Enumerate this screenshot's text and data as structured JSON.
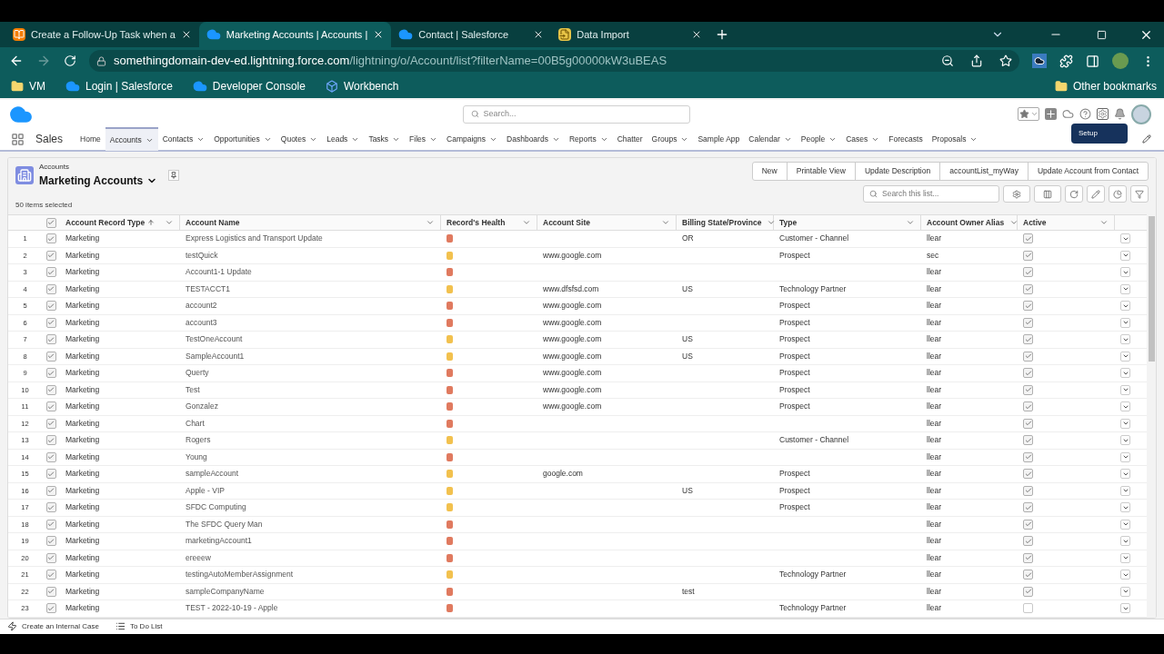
{
  "browser": {
    "tabs": [
      {
        "title": "Create a Follow-Up Task when a",
        "selected": false
      },
      {
        "title": "Marketing Accounts | Accounts |",
        "selected": true
      },
      {
        "title": "Contact | Salesforce",
        "selected": false
      },
      {
        "title": "Data Import",
        "selected": false
      }
    ],
    "url_host": "somethingdomain-dev-ed.lightning.force.com",
    "url_path": "/lightning/o/Account/list?filterName=00B5g00000kW3uBEAS",
    "bookmarks": [
      "VM",
      "Login | Salesforce",
      "Developer Console",
      "Workbench"
    ],
    "other_bookmarks": "Other bookmarks"
  },
  "app": {
    "search_placeholder": "Search...",
    "app_name": "Sales",
    "tooltip": "Setup",
    "nav": [
      {
        "label": "Home",
        "menu": false,
        "selected": false
      },
      {
        "label": "Accounts",
        "menu": true,
        "selected": true
      },
      {
        "label": "Contacts",
        "menu": true,
        "selected": false
      },
      {
        "label": "Opportunities",
        "menu": true,
        "selected": false
      },
      {
        "label": "Quotes",
        "menu": true,
        "selected": false
      },
      {
        "label": "Leads",
        "menu": true,
        "selected": false
      },
      {
        "label": "Tasks",
        "menu": true,
        "selected": false
      },
      {
        "label": "Files",
        "menu": true,
        "selected": false
      },
      {
        "label": "Campaigns",
        "menu": true,
        "selected": false
      },
      {
        "label": "Dashboards",
        "menu": true,
        "selected": false
      },
      {
        "label": "Reports",
        "menu": true,
        "selected": false
      },
      {
        "label": "Chatter",
        "menu": false,
        "selected": false
      },
      {
        "label": "Groups",
        "menu": true,
        "selected": false
      },
      {
        "label": "Sample App",
        "menu": false,
        "selected": false
      },
      {
        "label": "Calendar",
        "menu": true,
        "selected": false
      },
      {
        "label": "People",
        "menu": true,
        "selected": false
      },
      {
        "label": "Cases",
        "menu": true,
        "selected": false
      },
      {
        "label": "Forecasts",
        "menu": false,
        "selected": false
      },
      {
        "label": "Proposals",
        "menu": true,
        "selected": false
      }
    ]
  },
  "list": {
    "object": "Accounts",
    "title": "Marketing Accounts",
    "selected_count": "50 items selected",
    "all_checked": true,
    "actions": [
      "New",
      "Printable View",
      "Update Description",
      "accountList_myWay",
      "Update Account from Contact"
    ],
    "search_placeholder": "Search this list...",
    "columns": [
      {
        "label": "Account Record Type",
        "sorted": true
      },
      {
        "label": "Account Name",
        "sorted": false
      },
      {
        "label": "Record's Health",
        "sorted": false
      },
      {
        "label": "Account Site",
        "sorted": false
      },
      {
        "label": "Billing State/Province",
        "sorted": false
      },
      {
        "label": "Type",
        "sorted": false
      },
      {
        "label": "Account Owner Alias",
        "sorted": false
      },
      {
        "label": "Active",
        "sorted": false
      }
    ],
    "rows": [
      {
        "num": "1",
        "checked": true,
        "record_type": "Marketing",
        "name": "Express Logistics and Transport Update",
        "color": "#e07a5f",
        "site": "",
        "state": "OR",
        "type": "Customer - Channel",
        "owner": "llear",
        "active": true
      },
      {
        "num": "2",
        "checked": true,
        "record_type": "Marketing",
        "name": "testQuick",
        "color": "#f2c14e",
        "site": "www.google.com",
        "state": "",
        "type": "Prospect",
        "owner": "sec",
        "active": true
      },
      {
        "num": "3",
        "checked": true,
        "record_type": "Marketing",
        "name": "Account1-1 Update",
        "color": "#e07a5f",
        "site": "",
        "state": "",
        "type": "",
        "owner": "llear",
        "active": true
      },
      {
        "num": "4",
        "checked": true,
        "record_type": "Marketing",
        "name": "TESTACCT1",
        "color": "#f2c14e",
        "site": "www.dfsfsd.com",
        "state": "US",
        "type": "Technology Partner",
        "owner": "llear",
        "active": true
      },
      {
        "num": "5",
        "checked": true,
        "record_type": "Marketing",
        "name": "account2",
        "color": "#e07a5f",
        "site": "www.google.com",
        "state": "",
        "type": "Prospect",
        "owner": "llear",
        "active": true
      },
      {
        "num": "6",
        "checked": true,
        "record_type": "Marketing",
        "name": "account3",
        "color": "#e07a5f",
        "site": "www.google.com",
        "state": "",
        "type": "Prospect",
        "owner": "llear",
        "active": true
      },
      {
        "num": "7",
        "checked": true,
        "record_type": "Marketing",
        "name": "TestOneAccount",
        "color": "#f2c14e",
        "site": "www.google.com",
        "state": "US",
        "type": "Prospect",
        "owner": "llear",
        "active": true
      },
      {
        "num": "8",
        "checked": true,
        "record_type": "Marketing",
        "name": "SampleAccount1",
        "color": "#f2c14e",
        "site": "www.google.com",
        "state": "US",
        "type": "Prospect",
        "owner": "llear",
        "active": true
      },
      {
        "num": "9",
        "checked": true,
        "record_type": "Marketing",
        "name": "Querty",
        "color": "#e07a5f",
        "site": "www.google.com",
        "state": "",
        "type": "Prospect",
        "owner": "llear",
        "active": true
      },
      {
        "num": "10",
        "checked": true,
        "record_type": "Marketing",
        "name": "Test",
        "color": "#e07a5f",
        "site": "www.google.com",
        "state": "",
        "type": "Prospect",
        "owner": "llear",
        "active": true
      },
      {
        "num": "11",
        "checked": true,
        "record_type": "Marketing",
        "name": "Gonzalez",
        "color": "#e07a5f",
        "site": "www.google.com",
        "state": "",
        "type": "Prospect",
        "owner": "llear",
        "active": true
      },
      {
        "num": "12",
        "checked": true,
        "record_type": "Marketing",
        "name": "Chart",
        "color": "#e07a5f",
        "site": "",
        "state": "",
        "type": "",
        "owner": "llear",
        "active": true
      },
      {
        "num": "13",
        "checked": true,
        "record_type": "Marketing",
        "name": "Rogers",
        "color": "#f2c14e",
        "site": "",
        "state": "",
        "type": "Customer - Channel",
        "owner": "llear",
        "active": true
      },
      {
        "num": "14",
        "checked": true,
        "record_type": "Marketing",
        "name": "Young",
        "color": "#e07a5f",
        "site": "",
        "state": "",
        "type": "",
        "owner": "llear",
        "active": true
      },
      {
        "num": "15",
        "checked": true,
        "record_type": "Marketing",
        "name": "sampleAccount",
        "color": "#f2c14e",
        "site": "google.com",
        "state": "",
        "type": "Prospect",
        "owner": "llear",
        "active": true
      },
      {
        "num": "16",
        "checked": true,
        "record_type": "Marketing",
        "name": "Apple - VIP",
        "color": "#f2c14e",
        "site": "",
        "state": "US",
        "type": "Prospect",
        "owner": "llear",
        "active": true
      },
      {
        "num": "17",
        "checked": true,
        "record_type": "Marketing",
        "name": "SFDC Computing",
        "color": "#f2c14e",
        "site": "",
        "state": "",
        "type": "Prospect",
        "owner": "llear",
        "active": true
      },
      {
        "num": "18",
        "checked": true,
        "record_type": "Marketing",
        "name": "The SFDC Query Man",
        "color": "#e07a5f",
        "site": "",
        "state": "",
        "type": "",
        "owner": "llear",
        "active": true
      },
      {
        "num": "19",
        "checked": true,
        "record_type": "Marketing",
        "name": "marketingAccount1",
        "color": "#e07a5f",
        "site": "",
        "state": "",
        "type": "",
        "owner": "llear",
        "active": true
      },
      {
        "num": "20",
        "checked": true,
        "record_type": "Marketing",
        "name": "ereeew",
        "color": "#e07a5f",
        "site": "",
        "state": "",
        "type": "",
        "owner": "llear",
        "active": true
      },
      {
        "num": "21",
        "checked": true,
        "record_type": "Marketing",
        "name": "testingAutoMemberAssignment",
        "color": "#f2c14e",
        "site": "",
        "state": "",
        "type": "Technology Partner",
        "owner": "llear",
        "active": true
      },
      {
        "num": "22",
        "checked": true,
        "record_type": "Marketing",
        "name": "sampleCompanyName",
        "color": "#e07a5f",
        "site": "",
        "state": "test",
        "type": "",
        "owner": "llear",
        "active": true
      },
      {
        "num": "23",
        "checked": true,
        "record_type": "Marketing",
        "name": "TEST - 2022-10-19 - Apple",
        "color": "#e07a5f",
        "site": "",
        "state": "",
        "type": "Technology Partner",
        "owner": "llear",
        "active": false
      }
    ]
  },
  "utility_bar": [
    "Create an Internal Case",
    "To Do List"
  ]
}
